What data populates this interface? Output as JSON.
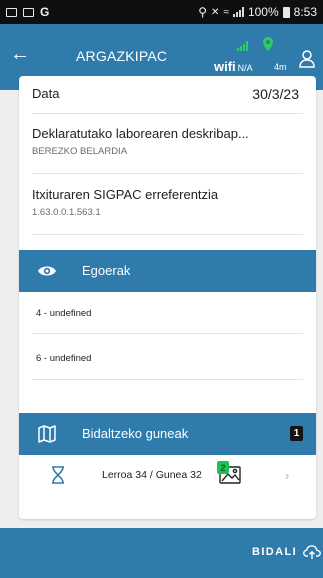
{
  "status_bar": {
    "left_letter": "G",
    "percent": "100%",
    "time": "8:53"
  },
  "app_bar": {
    "title": "ARGAZKIPAC",
    "wifi_label": "wifi",
    "wifi_value": "N/A",
    "accuracy": "4m"
  },
  "details": {
    "date_label": "Data",
    "date_value": "30/3/23",
    "work_label": "Deklaratutako laborearen deskribap...",
    "work_value": "BEREZKO BELARDIA",
    "sigpac_label": "Itxituraren SIGPAC erreferentzia",
    "sigpac_value": "1.63.0.0.1.563.1"
  },
  "states": {
    "title": "Egoerak",
    "items": [
      "4 - undefined",
      "6 - undefined"
    ]
  },
  "send_points": {
    "title": "Bidaltzeko guneak",
    "count": "1",
    "route_label": "Lerroa 34 / Gunea 32",
    "photo_count": "2"
  },
  "bottom": {
    "send_label": "BIDALI"
  },
  "colors": {
    "primary": "#2f7bab",
    "signal_green": "#2dcc5f",
    "badge_green": "#1fbf5a"
  }
}
